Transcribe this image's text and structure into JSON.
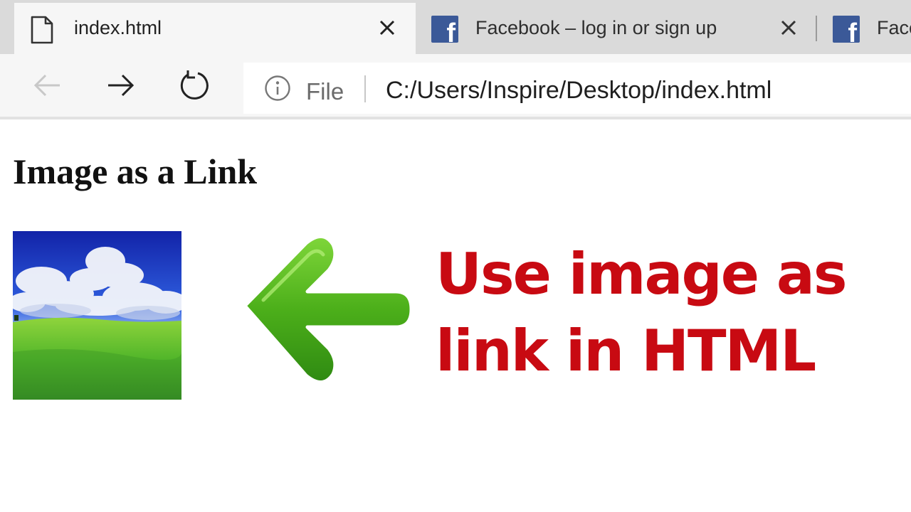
{
  "browser": {
    "tabs": [
      {
        "title": "index.html",
        "icon": "document-icon",
        "active": true
      },
      {
        "title": "Facebook – log in or sign up",
        "icon": "facebook-icon",
        "active": false
      },
      {
        "title": "Face",
        "icon": "facebook-icon",
        "active": false
      }
    ],
    "facebook_glyph": "f",
    "address_bar": {
      "info_icon": "info-icon",
      "scheme_label": "File",
      "url": "C:/Users/Inspire/Desktop/index.html"
    },
    "nav_buttons": [
      "back-arrow-icon",
      "forward-arrow-icon",
      "refresh-icon"
    ]
  },
  "page": {
    "heading": "Image as a Link",
    "image_link": {
      "image_name": "landscape-image"
    },
    "caption_line1": "Use image as",
    "caption_line2": "link in HTML",
    "caption_color": "#c80a12",
    "arrow_icon": "left-arrow-icon"
  },
  "colors": {
    "tabstrip": "#dadada",
    "active_tab": "#f6f6f6",
    "facebook_blue": "#3b5998",
    "arrow_green": "#4caf1a"
  }
}
